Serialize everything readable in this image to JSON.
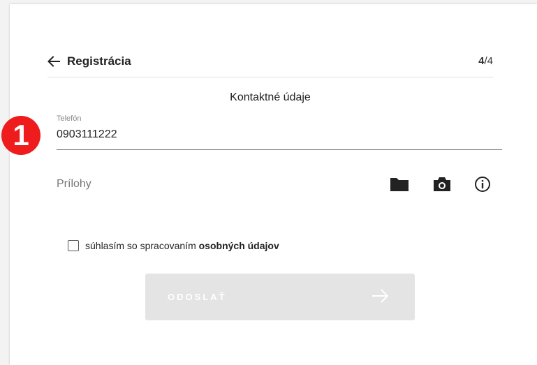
{
  "header": {
    "title": "Registrácia",
    "step_current": "4",
    "step_total": "/4",
    "back_icon": "arrow-left-icon"
  },
  "section": {
    "title": "Kontaktné údaje"
  },
  "annotation": {
    "marker": "1",
    "color": "#ee1c1c"
  },
  "phone": {
    "label": "Telefón",
    "value": "0903111222"
  },
  "attachments": {
    "label": "Prílohy",
    "icons": [
      "folder-icon",
      "camera-icon",
      "info-icon"
    ]
  },
  "consent": {
    "text": "súhlasím so spracovaním ",
    "bold": "osobných údajov",
    "checked": false
  },
  "submit": {
    "label": "ODOSLAŤ",
    "icon": "arrow-right-icon",
    "disabled": true
  }
}
